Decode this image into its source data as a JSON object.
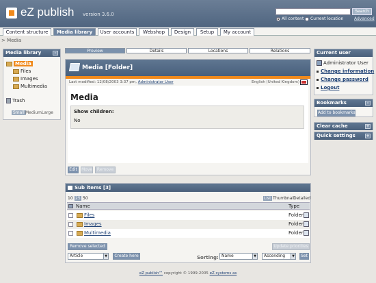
{
  "header": {
    "logo_text": "eZ publish",
    "version": "version 3.6.0",
    "search_button": "Search",
    "radio_all": "All content",
    "radio_current": "Current location",
    "advanced": "Advanced"
  },
  "nav": {
    "tabs": [
      "Content structure",
      "Media library",
      "User accounts",
      "Webshop",
      "Design",
      "Setup",
      "My account"
    ],
    "active": "Media library"
  },
  "breadcrumb": "> Media",
  "left": {
    "title": "Media library",
    "minimize": "–",
    "tree": [
      {
        "label": "Media",
        "selected": true
      },
      {
        "label": "Files"
      },
      {
        "label": "Images"
      },
      {
        "label": "Multimedia"
      }
    ],
    "trash": "Trash",
    "sizes": [
      "Small",
      "Medium",
      "Large"
    ],
    "active_size": "Small"
  },
  "view_tabs": [
    "Preview",
    "Details",
    "Locations",
    "Relations"
  ],
  "main": {
    "title": "Media [Folder]",
    "modified": "Last modified: 12/08/2003 3:37 pm,",
    "modifier": "Administrator User",
    "language": "English (United Kingdom)",
    "heading": "Media",
    "attr_label": "Show children:",
    "attr_value": "No",
    "buttons": [
      "Edit",
      "Move",
      "Remove"
    ]
  },
  "sub_items": {
    "title": "Sub items [3]",
    "page_sizes": [
      "10",
      "25",
      "50"
    ],
    "active_page_size": "25",
    "view_modes": [
      "List",
      "Thumbnail",
      "Detailed"
    ],
    "active_view_mode": "List",
    "col_name": "Name",
    "col_type": "Type",
    "rows": [
      {
        "name": "Files",
        "type": "Folder"
      },
      {
        "name": "Images",
        "type": "Folder"
      },
      {
        "name": "Multimedia",
        "type": "Folder"
      }
    ],
    "remove_button": "Remove selected",
    "update_button": "Update priorities",
    "class_select": "Article",
    "create_button": "Create here",
    "sorting_label": "Sorting:",
    "sort_field": "Name",
    "sort_order": "Ascending",
    "set_button": "Set"
  },
  "right": {
    "current_user_title": "Current user",
    "user_name": "Administrator User",
    "links": [
      "Change information",
      "Change password",
      "Logout"
    ],
    "bookmarks_title": "Bookmarks",
    "bookmarks_minus": "–",
    "add_bookmark": "Add to bookmarks",
    "clear_cache_title": "Clear cache",
    "quick_settings_title": "Quick settings",
    "plus": "+"
  },
  "footer": {
    "prefix": "eZ publish™",
    "middle": " copyright © 1999-2005 ",
    "company": "eZ systems as"
  }
}
